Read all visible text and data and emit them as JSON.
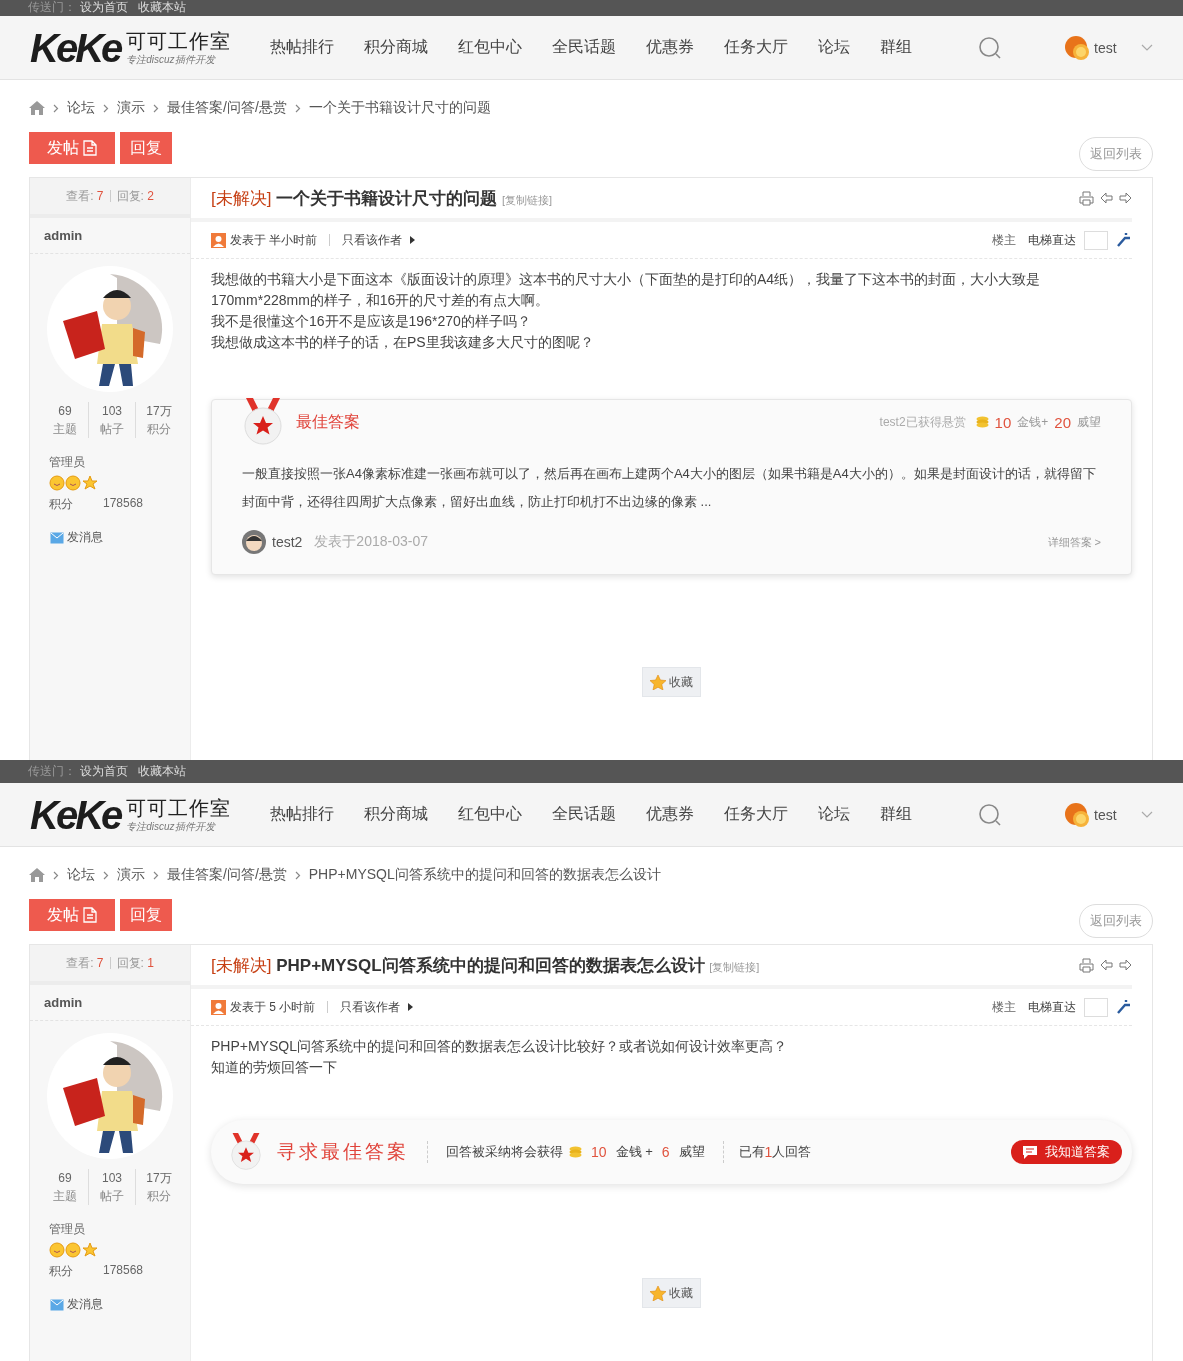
{
  "screens": [
    {
      "topbar": {
        "label": "传送门：",
        "links": [
          "设为首页",
          "收藏本站"
        ]
      },
      "header": {
        "logo_mark": "KeKe",
        "logo_name": "可可工作室",
        "logo_tagline": "专注discuz插件开发",
        "nav": [
          "热帖排行",
          "积分商城",
          "红包中心",
          "全民话题",
          "优惠券",
          "任务大厅",
          "论坛",
          "群组"
        ],
        "user": "test"
      },
      "breadcrumb": [
        "论坛",
        "演示",
        "最佳答案/问答/悬赏",
        "一个关于书籍设计尺寸的问题"
      ],
      "actions": {
        "post": "发帖",
        "reply": "回复",
        "back": "返回列表"
      },
      "thread": {
        "views_label": "查看:",
        "views": "7",
        "replies_label": "回复:",
        "replies": "2",
        "status": "[未解决]",
        "title": "一个关于书籍设计尺寸的问题",
        "copy_link": "[复制链接]",
        "author": {
          "name": "admin",
          "stats": [
            {
              "value": "69",
              "label": "主题"
            },
            {
              "value": "103",
              "label": "帖子"
            },
            {
              "value": "17万",
              "label": "积分"
            }
          ],
          "group": "管理员",
          "points_label": "积分",
          "points": "178568",
          "message": "发消息"
        },
        "posted": "发表于 半小时前",
        "only_author": "只看该作者",
        "floor": "楼主",
        "jump": "电梯直达",
        "paragraphs": [
          "我想做的书籍大小是下面这本《版面设计的原理》这本书的尺寸大小（下面垫的是打印的A4纸），我量了下这本书的封面，大小大致是170mm*228mm的样子，和16开的尺寸差的有点大啊。",
          "我不是很懂这个16开不是应该是196*270的样子吗？",
          "我想做成这本书的样子的话，在PS里我该建多大尺寸的图呢？"
        ],
        "answer": {
          "kind": "best",
          "title": "最佳答案",
          "winner": "test2已获得悬赏",
          "money": "10",
          "money_label": "金钱+",
          "rep": "20",
          "rep_label": "威望",
          "text": "一般直接按照一张A4像素标准建一张画布就可以了，然后再在画布上建两个A4大小的图层（如果书籍是A4大小的）。如果是封面设计的话，就得留下封面中背，还得往四周扩大点像素，留好出血线，防止打印机打不出边缘的像素 ...",
          "user": "test2",
          "date": "发表于2018-03-07",
          "more": "详细答案 >"
        },
        "favorite": "收藏"
      }
    },
    {
      "topbar": {
        "label": "传送门：",
        "links": [
          "设为首页",
          "收藏本站"
        ]
      },
      "header": {
        "logo_mark": "KeKe",
        "logo_name": "可可工作室",
        "logo_tagline": "专注discuz插件开发",
        "nav": [
          "热帖排行",
          "积分商城",
          "红包中心",
          "全民话题",
          "优惠券",
          "任务大厅",
          "论坛",
          "群组"
        ],
        "user": "test"
      },
      "breadcrumb": [
        "论坛",
        "演示",
        "最佳答案/问答/悬赏",
        "PHP+MYSQL问答系统中的提问和回答的数据表怎么设计"
      ],
      "actions": {
        "post": "发帖",
        "reply": "回复",
        "back": "返回列表"
      },
      "thread": {
        "views_label": "查看:",
        "views": "7",
        "replies_label": "回复:",
        "replies": "1",
        "status": "[未解决]",
        "title": "PHP+MYSQL问答系统中的提问和回答的数据表怎么设计",
        "copy_link": "[复制链接]",
        "author": {
          "name": "admin",
          "stats": [
            {
              "value": "69",
              "label": "主题"
            },
            {
              "value": "103",
              "label": "帖子"
            },
            {
              "value": "17万",
              "label": "积分"
            }
          ],
          "group": "管理员",
          "points_label": "积分",
          "points": "178568",
          "message": "发消息"
        },
        "posted": "发表于 5 小时前",
        "only_author": "只看该作者",
        "floor": "楼主",
        "jump": "电梯直达",
        "paragraphs": [
          "PHP+MYSQL问答系统中的提问和回答的数据表怎么设计比较好？或者说如何设计效率更高？",
          "知道的劳烦回答一下"
        ],
        "answer": {
          "kind": "seek",
          "title": "寻求最佳答案",
          "reward_label": "回答被采纳将会获得",
          "money": "10",
          "money_label": "金钱 +",
          "rep": "6",
          "rep_label": "威望",
          "count_prefix": "已有",
          "count": "1",
          "count_suffix": "人回答",
          "button": "我知道答案"
        },
        "favorite": "收藏"
      }
    }
  ]
}
